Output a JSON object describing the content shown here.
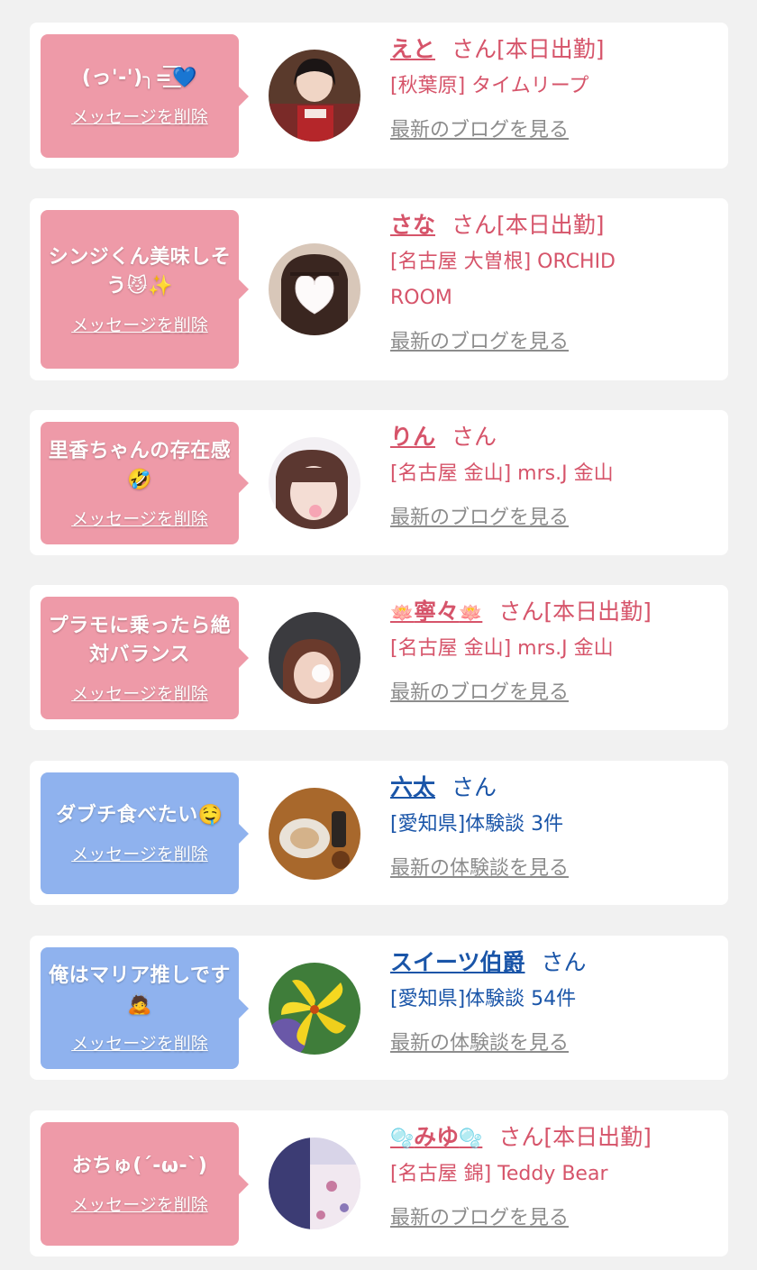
{
  "cards": [
    {
      "theme": "pink",
      "message": "(っ'-')╮=͟͟͞͞💙",
      "delete_label": "メッセージを削除",
      "name": "えと",
      "name_prefix": "",
      "name_suffix": "",
      "honorific": "さん[本日出勤]",
      "shop": "[秋葉原] タイムリープ",
      "link": "最新のブログを見る"
    },
    {
      "theme": "pink",
      "message": "シンジくん美味しそう😼✨",
      "delete_label": "メッセージを削除",
      "name": "さな",
      "name_prefix": "",
      "name_suffix": "",
      "honorific": "さん[本日出勤]",
      "shop": "[名古屋 大曽根] ORCHID ROOM",
      "link": "最新のブログを見る"
    },
    {
      "theme": "pink",
      "message": "里香ちゃんの存在感🤣",
      "delete_label": "メッセージを削除",
      "name": "りん",
      "name_prefix": "",
      "name_suffix": "",
      "honorific": "さん",
      "shop": "[名古屋 金山] mrs.J 金山",
      "link": "最新のブログを見る"
    },
    {
      "theme": "pink",
      "message": "プラモに乗ったら絶対バランス",
      "delete_label": "メッセージを削除",
      "name": "寧々",
      "name_prefix": "🪷",
      "name_suffix": "🪷",
      "honorific": "さん[本日出勤]",
      "shop": "[名古屋 金山] mrs.J 金山",
      "link": "最新のブログを見る"
    },
    {
      "theme": "blue",
      "message": "ダブチ食べたい🤤",
      "delete_label": "メッセージを削除",
      "name": "六太",
      "name_prefix": "",
      "name_suffix": "",
      "honorific": "さん",
      "shop": "[愛知県]体験談 3件",
      "link": "最新の体験談を見る"
    },
    {
      "theme": "blue",
      "message": "俺はマリア推しです🙇",
      "delete_label": "メッセージを削除",
      "name": "スイーツ伯爵",
      "name_prefix": "",
      "name_suffix": "",
      "honorific": "さん",
      "shop": "[愛知県]体験談 54件",
      "link": "最新の体験談を見る"
    },
    {
      "theme": "pink",
      "message": "おちゅ(´-ω-`)",
      "delete_label": "メッセージを削除",
      "name": "みゆ",
      "name_prefix": "🫧",
      "name_suffix": "🫧",
      "honorific": "さん[本日出勤]",
      "shop": "[名古屋 錦] Teddy Bear",
      "link": "最新のブログを見る"
    }
  ]
}
